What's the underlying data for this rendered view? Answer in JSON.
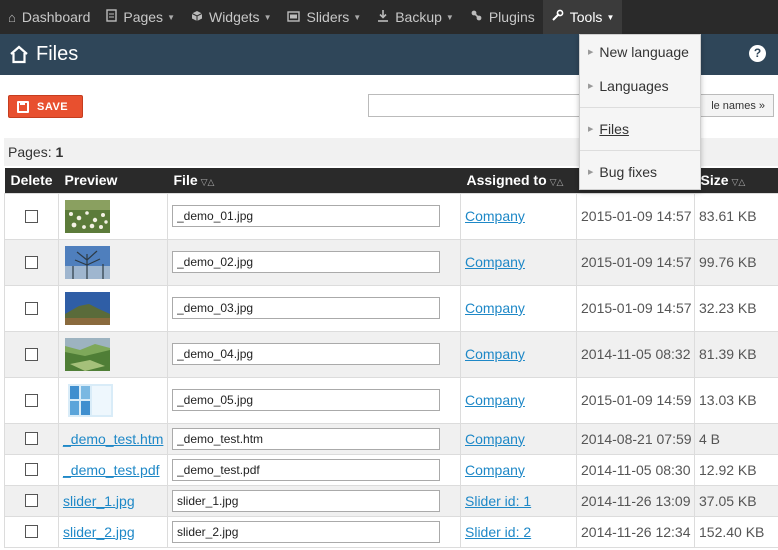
{
  "nav": {
    "items": [
      {
        "icon": "home-icon",
        "label": "Dashboard",
        "caret": false
      },
      {
        "icon": "document-icon",
        "label": "Pages",
        "caret": true
      },
      {
        "icon": "cube-icon",
        "label": "Widgets",
        "caret": true
      },
      {
        "icon": "slider-icon",
        "label": "Sliders",
        "caret": true
      },
      {
        "icon": "download-icon",
        "label": "Backup",
        "caret": true
      },
      {
        "icon": "plugin-icon",
        "label": "Plugins",
        "caret": false
      },
      {
        "icon": "wrench-icon",
        "label": "Tools",
        "caret": true
      }
    ]
  },
  "header": {
    "title": "Files",
    "help": "?"
  },
  "toolbar": {
    "save_label": "SAVE",
    "search_value": "",
    "search_button_label": "le names »"
  },
  "pages": {
    "label": "Pages:",
    "value": "1"
  },
  "table": {
    "columns": {
      "delete": "Delete",
      "preview": "Preview",
      "file": "File",
      "assigned": "Assigned to",
      "size": "Size",
      "sort_indicator": "▽△"
    },
    "rows": [
      {
        "preview_type": "image",
        "thumb": "flowers",
        "filename": "_demo_01.jpg",
        "assigned": "Company",
        "date": "2015-01-09 14:57",
        "size": "83.61 KB"
      },
      {
        "preview_type": "image",
        "thumb": "tree-sky",
        "filename": "_demo_02.jpg",
        "assigned": "Company",
        "date": "2015-01-09 14:57",
        "size": "99.76 KB"
      },
      {
        "preview_type": "image",
        "thumb": "hill",
        "filename": "_demo_03.jpg",
        "assigned": "Company",
        "date": "2015-01-09 14:57",
        "size": "32.23 KB"
      },
      {
        "preview_type": "image",
        "thumb": "valley",
        "filename": "_demo_04.jpg",
        "assigned": "Company",
        "date": "2014-11-05 08:32",
        "size": "81.39 KB"
      },
      {
        "preview_type": "image",
        "thumb": "glass",
        "filename": "_demo_05.jpg",
        "assigned": "Company",
        "date": "2015-01-09 14:59",
        "size": "13.03 KB"
      },
      {
        "preview_type": "link",
        "preview_text": "_demo_test.htm",
        "filename": "_demo_test.htm",
        "assigned": "Company",
        "date": "2014-08-21 07:59",
        "size": "4 B"
      },
      {
        "preview_type": "link",
        "preview_text": "_demo_test.pdf",
        "filename": "_demo_test.pdf",
        "assigned": "Company",
        "date": "2014-11-05 08:30",
        "size": "12.92 KB"
      },
      {
        "preview_type": "link",
        "preview_text": "slider_1.jpg",
        "filename": "slider_1.jpg",
        "assigned": "Slider id: 1",
        "date": "2014-11-26 13:09",
        "size": "37.05 KB"
      },
      {
        "preview_type": "link",
        "preview_text": "slider_2.jpg",
        "filename": "slider_2.jpg",
        "assigned": "Slider id: 2",
        "date": "2014-11-26 12:34",
        "size": "152.40 KB"
      }
    ]
  },
  "tools_menu": {
    "items": [
      "New language",
      "Languages",
      "Files",
      "Bug fixes"
    ]
  },
  "colors": {
    "nav_bg": "#2a2a2a",
    "header_bg": "#2f4659",
    "save_button": "#e8502f",
    "link": "#1e88c7"
  }
}
